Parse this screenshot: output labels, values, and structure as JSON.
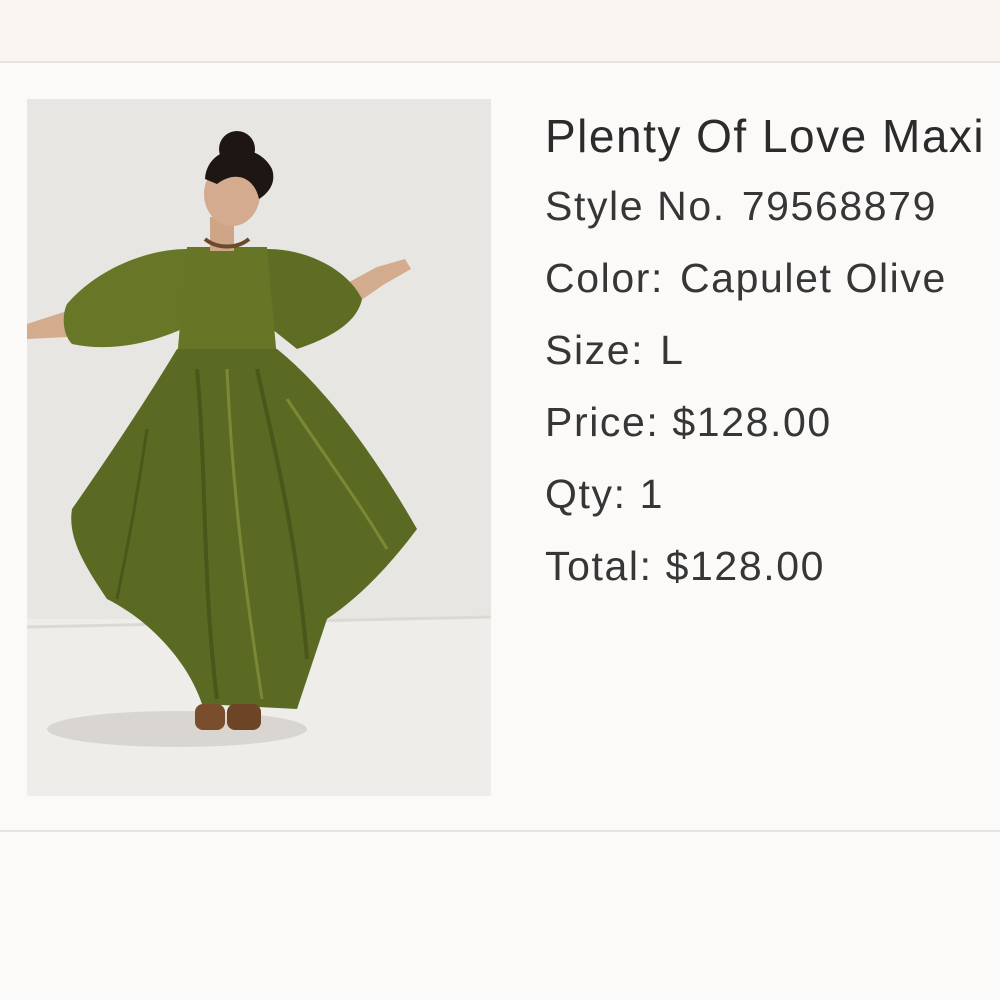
{
  "product": {
    "title": "Plenty Of Love Maxi",
    "image_alt": "Woman twirling in an olive green flowing maxi dress",
    "style_label": "Style No.",
    "style_value": "79568879",
    "color_label": "Color:",
    "color_value": "Capulet Olive",
    "size_label": "Size:",
    "size_value": "L",
    "price_label": "Price:",
    "price_value": "$128.00",
    "qty_label": "Qty:",
    "qty_value": "1",
    "total_label": "Total:",
    "total_value": "$128.00"
  },
  "colors": {
    "background": "#fcfaf9",
    "divider": "#e6e3e1",
    "text": "#333333",
    "dress": "#5b6a22"
  }
}
